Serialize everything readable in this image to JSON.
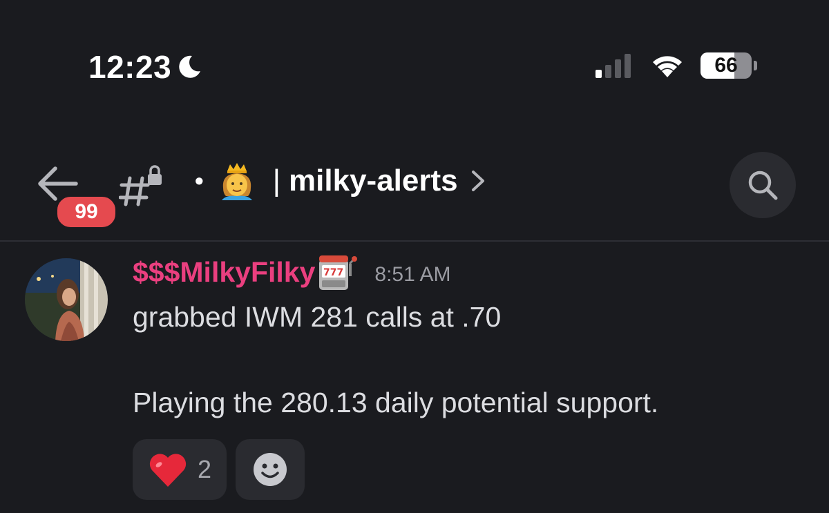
{
  "status_bar": {
    "time": "12:23",
    "battery_level": "66",
    "battery_fraction": 0.66
  },
  "header": {
    "unread_count": "99",
    "separator_dot": "•",
    "separator_bar": "|",
    "channel_name": "milky-alerts"
  },
  "message": {
    "username": "$$$MilkyFilky",
    "timestamp": "8:51 AM",
    "line1": "grabbed IWM 281 calls at .70",
    "line2": "Playing the 280.13 daily potential support."
  },
  "reactions": [
    {
      "icon": "heart-icon",
      "count": "2"
    },
    {
      "icon": "add-reaction-smiley-icon"
    }
  ],
  "colors": {
    "background": "#1a1b1f",
    "username": "#ea3f7f",
    "badge": "#e54a4f",
    "chip": "#2a2b30"
  }
}
